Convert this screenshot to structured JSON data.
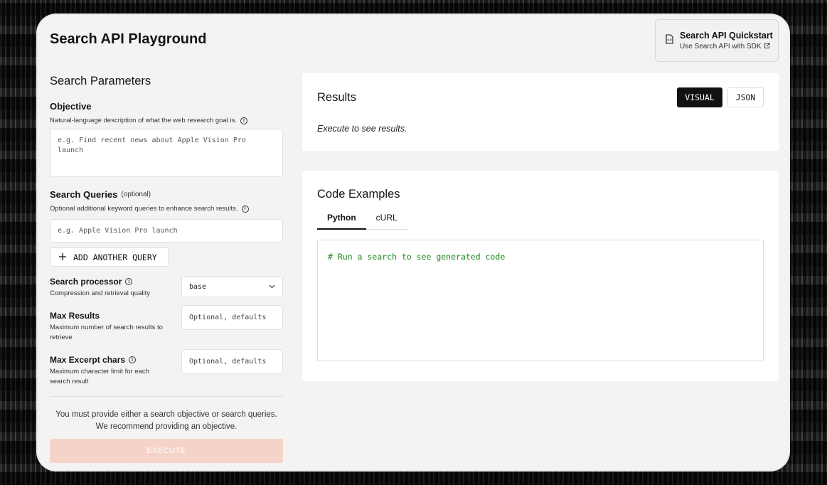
{
  "app": {
    "title": "Search API Playground"
  },
  "quickstart": {
    "title": "Search API Quickstart",
    "subtitle": "Use Search API with SDK",
    "icon": "document-code-icon",
    "link_icon": "external-link-icon"
  },
  "params": {
    "section_title": "Search Parameters",
    "objective": {
      "label": "Objective",
      "description": "Natural-language description of what the web research goal is.",
      "placeholder": "e.g. Find recent news about Apple Vision Pro launch",
      "value": ""
    },
    "queries": {
      "label": "Search Queries",
      "optional_tag": "(optional)",
      "description": "Optional additional keyword queries to enhance search results.",
      "placeholder": "e.g. Apple Vision Pro launch",
      "value": "",
      "add_button": "ADD ANOTHER QUERY"
    },
    "processor": {
      "label": "Search processor",
      "description": "Compression and retrieval quality",
      "selected": "base"
    },
    "max_results": {
      "label": "Max Results",
      "description": "Maximum number of search results to retrieve",
      "placeholder": "Optional, defaults"
    },
    "max_excerpt": {
      "label": "Max Excerpt chars",
      "description": "Maximum character limit for each search result",
      "placeholder": "Optional, defaults"
    },
    "notice": "You must provide either a search objective or search queries. We recommend providing an objective.",
    "execute_label": "EXECUTE"
  },
  "results": {
    "title": "Results",
    "toggle_visual": "VISUAL",
    "toggle_json": "JSON",
    "active_toggle": "VISUAL",
    "hint": "Execute to see results."
  },
  "code": {
    "title": "Code Examples",
    "tabs": [
      "Python",
      "cURL"
    ],
    "active_tab": "Python",
    "content": "# Run a search to see generated code"
  },
  "colors": {
    "execute_disabled": "#f6d3c8",
    "code_comment": "#1a8a1a",
    "active_toggle_bg": "#111111"
  }
}
